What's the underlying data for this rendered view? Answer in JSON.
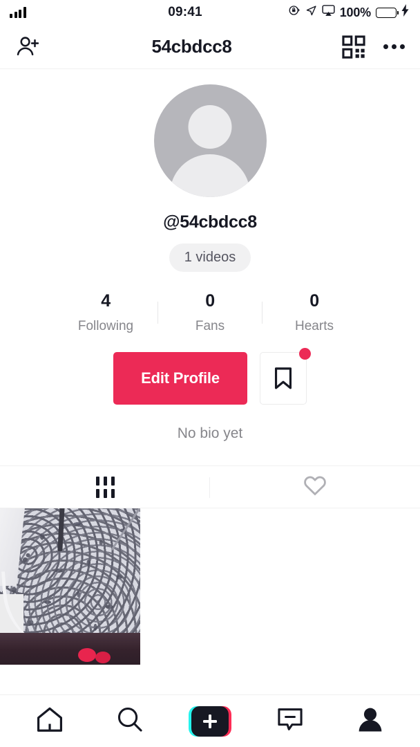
{
  "status_bar": {
    "time": "09:41",
    "battery_percent": "100%",
    "icons": [
      "signal-bars-icon",
      "rotation-lock-icon",
      "location-arrow-icon",
      "airplay-icon",
      "battery-icon",
      "charging-bolt-icon"
    ],
    "battery_color": "#45e065"
  },
  "header": {
    "title": "54cbdcc8",
    "add_friend_icon": "add-person-icon",
    "qr_icon": "qr-code-icon",
    "more_icon": "more-options-icon"
  },
  "profile": {
    "avatar_alt": "default-avatar",
    "username": "@54cbdcc8",
    "video_count_label": "1 videos",
    "bio": "No bio yet",
    "stats": [
      {
        "value": "4",
        "label": "Following"
      },
      {
        "value": "0",
        "label": "Fans"
      },
      {
        "value": "0",
        "label": "Hearts"
      }
    ],
    "edit_button_label": "Edit Profile",
    "edit_button_color": "#ec2a56",
    "bookmark_icon": "bookmark-icon",
    "bookmark_badge_color": "#ec2a56"
  },
  "content_tabs": [
    {
      "name": "videos-tab",
      "icon": "grid-icon",
      "active": true
    },
    {
      "name": "liked-tab",
      "icon": "heart-icon",
      "active": false
    }
  ],
  "videos": [
    {
      "name": "video-thumbnail-1",
      "alt": "carpet floor with white cable"
    }
  ],
  "bottom_nav": [
    {
      "name": "home",
      "icon": "home-icon",
      "active": false
    },
    {
      "name": "discover",
      "icon": "search-icon",
      "active": false
    },
    {
      "name": "create",
      "icon": "plus-icon",
      "active": false
    },
    {
      "name": "inbox",
      "icon": "inbox-icon",
      "active": false
    },
    {
      "name": "profile",
      "icon": "person-icon",
      "active": true
    }
  ],
  "colors": {
    "tiktok_cyan": "#25f4ee",
    "tiktok_pink": "#fe2c55",
    "accent_red": "#ec2a56",
    "text_primary": "#161823",
    "text_secondary": "#86868b"
  }
}
